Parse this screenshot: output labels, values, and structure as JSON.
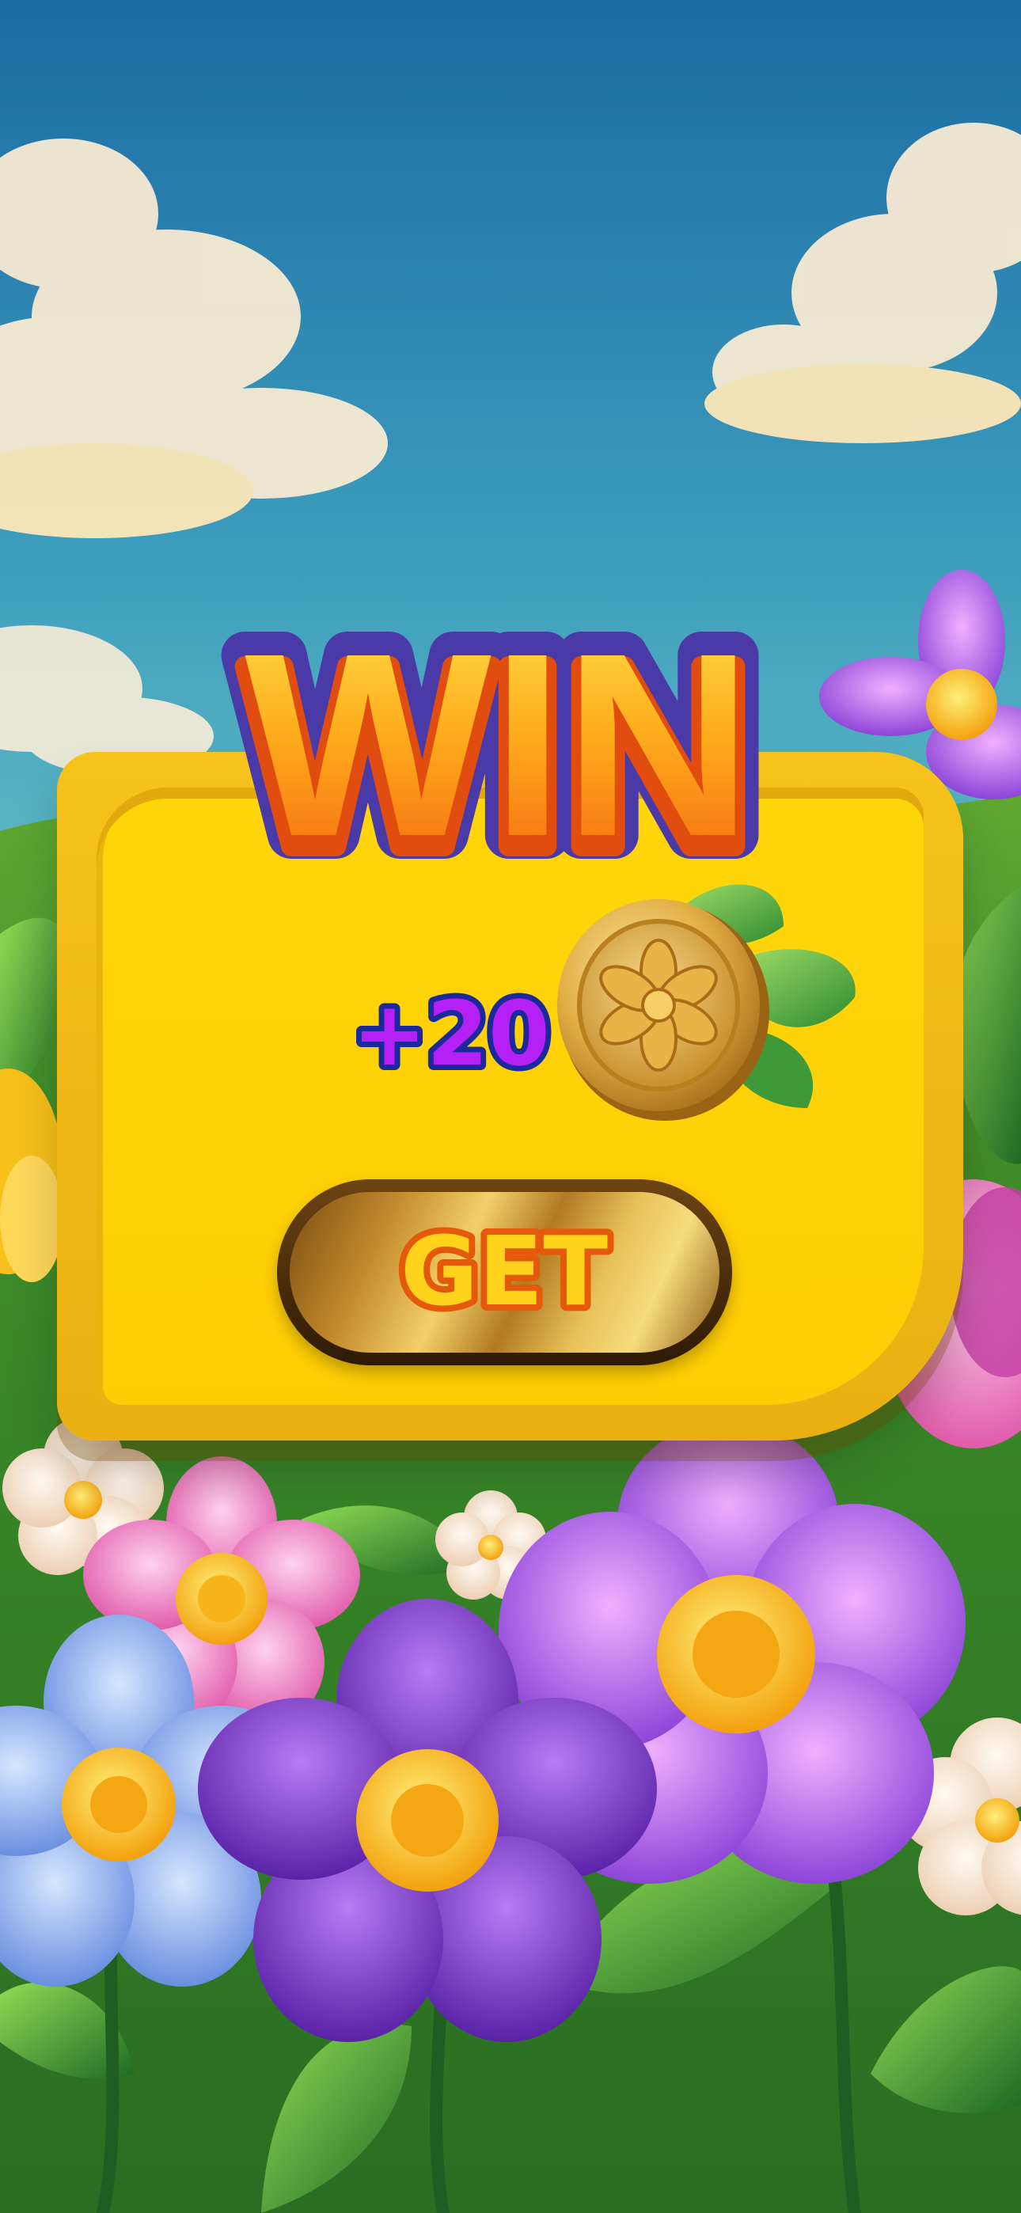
{
  "title": "WIN",
  "reward": {
    "amount_text": "+20",
    "currency_icon": "flower-coin-icon"
  },
  "button": {
    "label": "GET"
  },
  "colors": {
    "sky_top": "#1e6fa6",
    "sky_bottom": "#8fe0c8",
    "panel": "#ffcf08",
    "panel_border": "#f2b413",
    "win_fill": "#ffa51a",
    "win_outline": "#4a2fa3",
    "amount_fill": "#b520f5",
    "amount_outline": "#1a2a9c",
    "button_text": "#ffd21c",
    "button_text_outline": "#e4590a",
    "coin_gold": "#e5b64b"
  }
}
